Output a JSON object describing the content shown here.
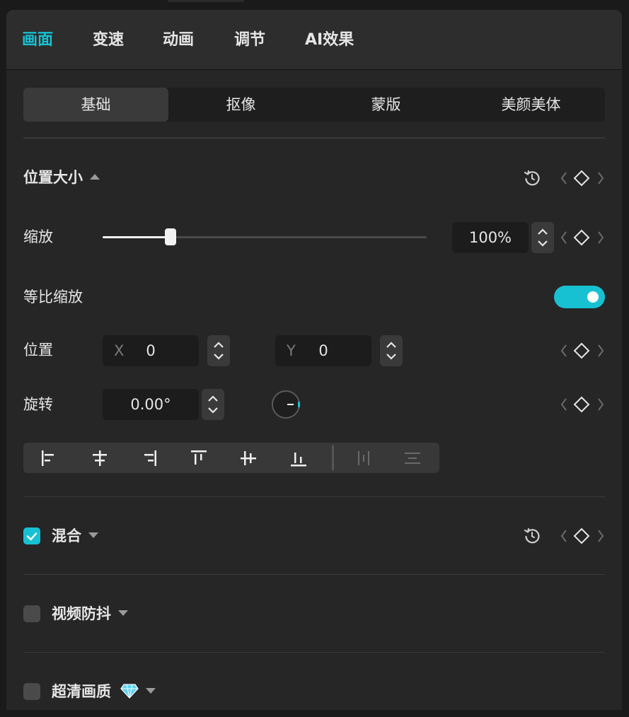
{
  "top_tabs": [
    {
      "label": "画面",
      "active": true
    },
    {
      "label": "变速",
      "active": false
    },
    {
      "label": "动画",
      "active": false
    },
    {
      "label": "调节",
      "active": false
    },
    {
      "label": "AI效果",
      "active": false
    }
  ],
  "sub_tabs": [
    {
      "label": "基础",
      "active": true
    },
    {
      "label": "抠像",
      "active": false
    },
    {
      "label": "蒙版",
      "active": false
    },
    {
      "label": "美颜美体",
      "active": false
    }
  ],
  "position_size": {
    "title": "位置大小",
    "scale": {
      "label": "缩放",
      "value": "100%",
      "slider_fraction": 0.21
    },
    "uniform_scale": {
      "label": "等比缩放",
      "enabled": true
    },
    "position": {
      "label": "位置",
      "x_axis": "X",
      "x_value": "0",
      "y_axis": "Y",
      "y_value": "0"
    },
    "rotation": {
      "label": "旋转",
      "value": "0.00°"
    }
  },
  "align_tools": [
    "align-left-icon",
    "align-center-horizontal-icon",
    "align-right-icon",
    "align-top-icon",
    "align-center-vertical-icon",
    "align-bottom-icon",
    "distribute-horizontal-icon",
    "distribute-vertical-icon"
  ],
  "sections": [
    {
      "label": "混合",
      "checked": true
    },
    {
      "label": "视频防抖",
      "checked": false
    },
    {
      "label": "超清画质",
      "checked": false,
      "badge": "diamond-icon"
    }
  ],
  "colors": {
    "accent": "#18c1d2",
    "panel": "#262626",
    "topbar": "#2d2d2d"
  }
}
